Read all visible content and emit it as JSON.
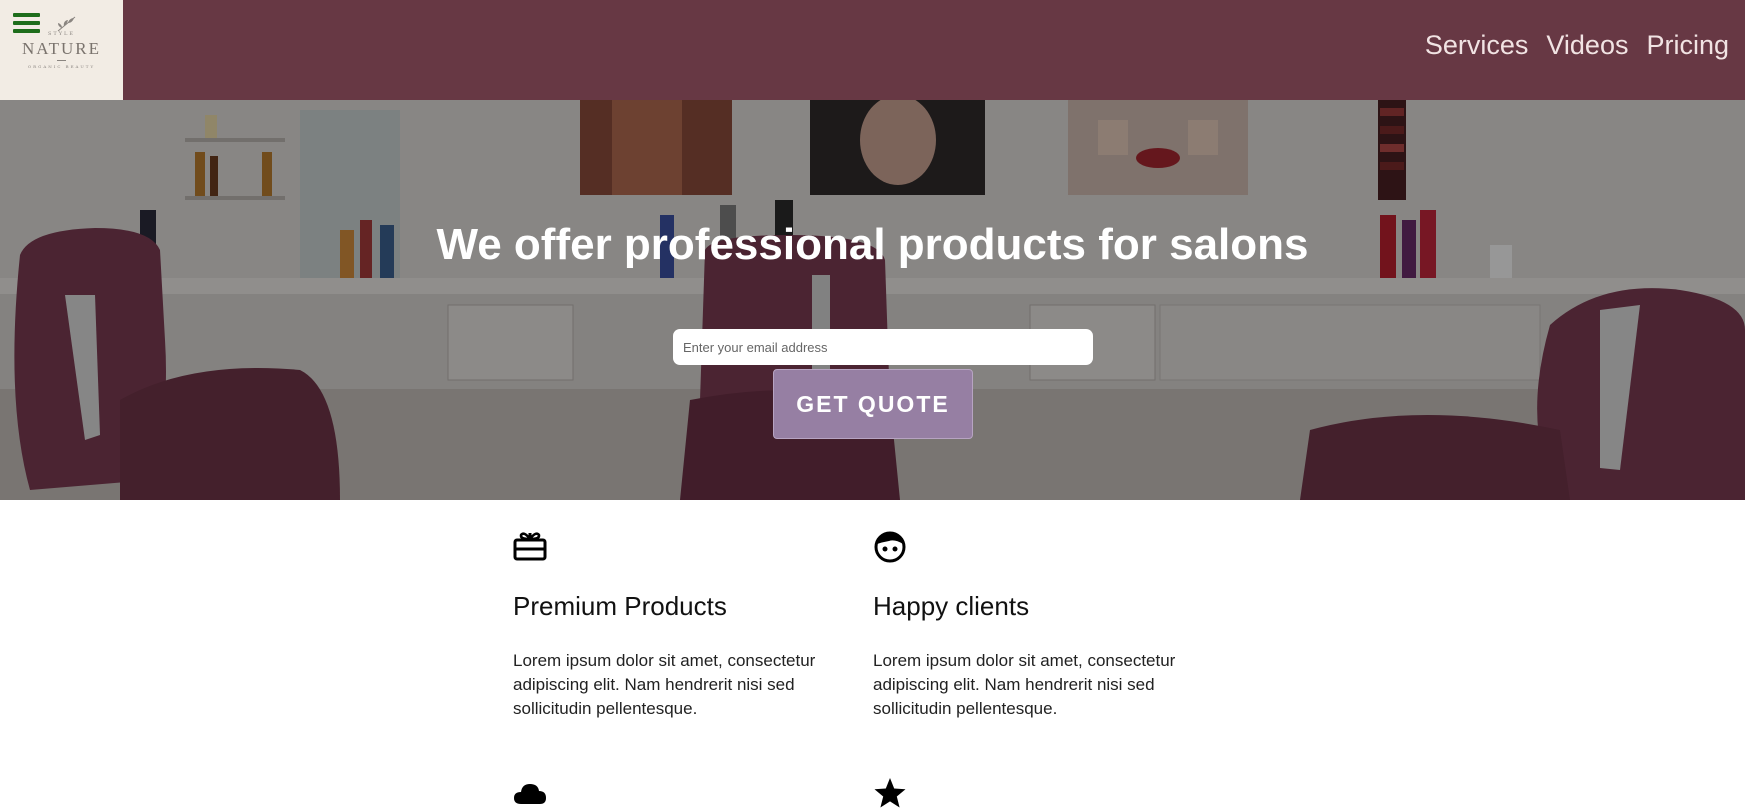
{
  "header": {
    "logo": {
      "top_text": "STYLE",
      "name": "NATURE",
      "tagline": "ORGANIC BEAUTY"
    },
    "nav": [
      {
        "label": "Services"
      },
      {
        "label": "Videos"
      },
      {
        "label": "Pricing"
      }
    ],
    "colors": {
      "bar": "#673844",
      "logo_bg": "#f2ece4",
      "menu_icon": "#1e6d1b"
    }
  },
  "hero": {
    "title": "We offer professional products for salons",
    "email_placeholder": "Enter your email address",
    "button_label": "GET QUOTE",
    "colors": {
      "button": "#967fa3",
      "chairs": "#7a3b52"
    }
  },
  "features": [
    {
      "icon": "gift-card-icon",
      "title": "Premium Products",
      "text": "Lorem ipsum dolor sit amet, consectetur adipiscing elit. Nam hendrerit nisi sed sollicitudin pellentesque."
    },
    {
      "icon": "face-icon",
      "title": "Happy clients",
      "text": "Lorem ipsum dolor sit amet, consectetur adipiscing elit. Nam hendrerit nisi sed sollicitudin pellentesque."
    },
    {
      "icon": "cloud-icon",
      "title": "",
      "text": ""
    },
    {
      "icon": "star-icon",
      "title": "",
      "text": ""
    }
  ]
}
